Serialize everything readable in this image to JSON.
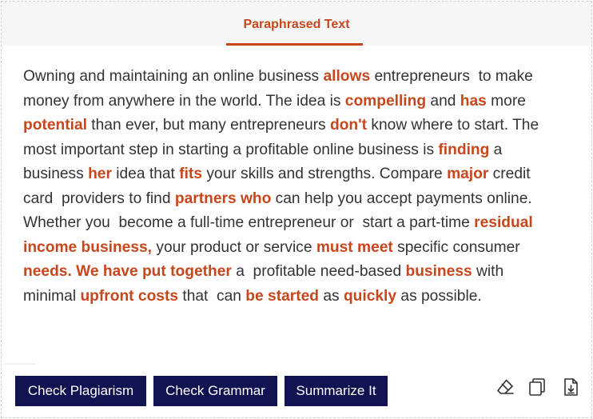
{
  "panel": {
    "tab_label": "Paraphrased Text"
  },
  "paraphrase": {
    "lines": [
      [
        {
          "t": "Owning and maintaining an online business ",
          "hl": false
        },
        {
          "t": "allows",
          "hl": true
        },
        {
          "t": " entrepreneurs  to make",
          "hl": false
        }
      ],
      [
        {
          "t": "money from anywhere in the world. The idea is ",
          "hl": false
        },
        {
          "t": "compelling",
          "hl": true
        },
        {
          "t": " and ",
          "hl": false
        },
        {
          "t": "has",
          "hl": true
        },
        {
          "t": " more",
          "hl": false
        }
      ],
      [
        {
          "t": "potential",
          "hl": true
        },
        {
          "t": " than ever, but many entrepreneurs ",
          "hl": false
        },
        {
          "t": "don't",
          "hl": true
        },
        {
          "t": " know where to start. The",
          "hl": false
        }
      ],
      [
        {
          "t": "most important step in starting a profitable online business is ",
          "hl": false
        },
        {
          "t": "finding",
          "hl": true
        },
        {
          "t": " a",
          "hl": false
        }
      ],
      [
        {
          "t": "business ",
          "hl": false
        },
        {
          "t": "her",
          "hl": true
        },
        {
          "t": " idea that ",
          "hl": false
        },
        {
          "t": "fits",
          "hl": true
        },
        {
          "t": " your skills and strengths. Compare ",
          "hl": false
        },
        {
          "t": "major",
          "hl": true
        },
        {
          "t": " credit",
          "hl": false
        }
      ],
      [
        {
          "t": "card  providers to find ",
          "hl": false
        },
        {
          "t": "partners who",
          "hl": true
        },
        {
          "t": " can help you accept payments online.",
          "hl": false
        }
      ],
      [
        {
          "t": "Whether you  become a full-time entrepreneur or  start a part-time ",
          "hl": false
        },
        {
          "t": "residual",
          "hl": true
        }
      ],
      [
        {
          "t": "income business,",
          "hl": true
        },
        {
          "t": " your product or service ",
          "hl": false
        },
        {
          "t": "must meet",
          "hl": true
        },
        {
          "t": " specific consumer",
          "hl": false
        }
      ],
      [
        {
          "t": "needs. We have put together",
          "hl": true
        },
        {
          "t": " a  profitable need-based ",
          "hl": false
        },
        {
          "t": "business",
          "hl": true
        },
        {
          "t": " with",
          "hl": false
        }
      ],
      [
        {
          "t": "minimal ",
          "hl": false
        },
        {
          "t": "upfront costs",
          "hl": true
        },
        {
          "t": " that  can ",
          "hl": false
        },
        {
          "t": "be started",
          "hl": true
        },
        {
          "t": " as ",
          "hl": false
        },
        {
          "t": "quickly",
          "hl": true
        },
        {
          "t": " as possible.",
          "hl": false
        }
      ]
    ]
  },
  "actions": {
    "check_plagiarism": "Check Plagiarism",
    "check_grammar": "Check Grammar",
    "summarize": "Summarize It"
  },
  "tools": {
    "icons": [
      "eraser-icon",
      "copy-icon",
      "download-icon"
    ]
  },
  "colors": {
    "accent": "#c7461c",
    "button_bg": "#111252",
    "button_text": "#ffffff",
    "body_text": "#333333"
  }
}
